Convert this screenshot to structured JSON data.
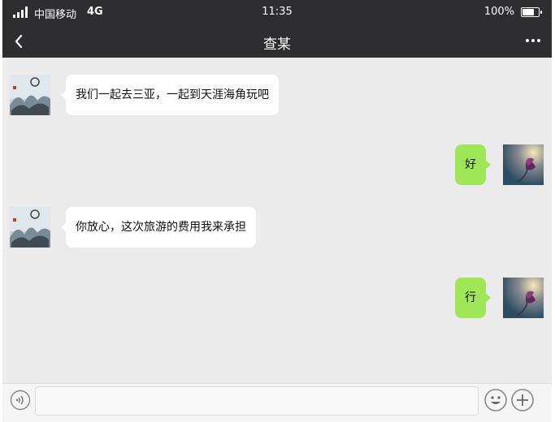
{
  "status_bar": {
    "carrier": "中国移动",
    "network": "4G",
    "time": "11:35",
    "battery": "100%"
  },
  "nav": {
    "title": "查某"
  },
  "messages": [
    {
      "side": "left",
      "text": "我们一起去三亚，一起到天涯海角玩吧"
    },
    {
      "side": "right",
      "text": "好"
    },
    {
      "side": "left",
      "text": "你放心，这次旅游的费用我来承担"
    },
    {
      "side": "right",
      "text": "行"
    }
  ],
  "input": {
    "value": "",
    "placeholder": ""
  },
  "colors": {
    "header_bg": "#2e2e30",
    "chat_bg": "#ebebeb",
    "sent_bubble": "#9fe658",
    "received_bubble": "#ffffff"
  },
  "icons": [
    "signal-icon",
    "battery-icon",
    "back-arrow-icon",
    "more-dots-icon",
    "voice-icon",
    "emoji-icon",
    "plus-icon"
  ]
}
